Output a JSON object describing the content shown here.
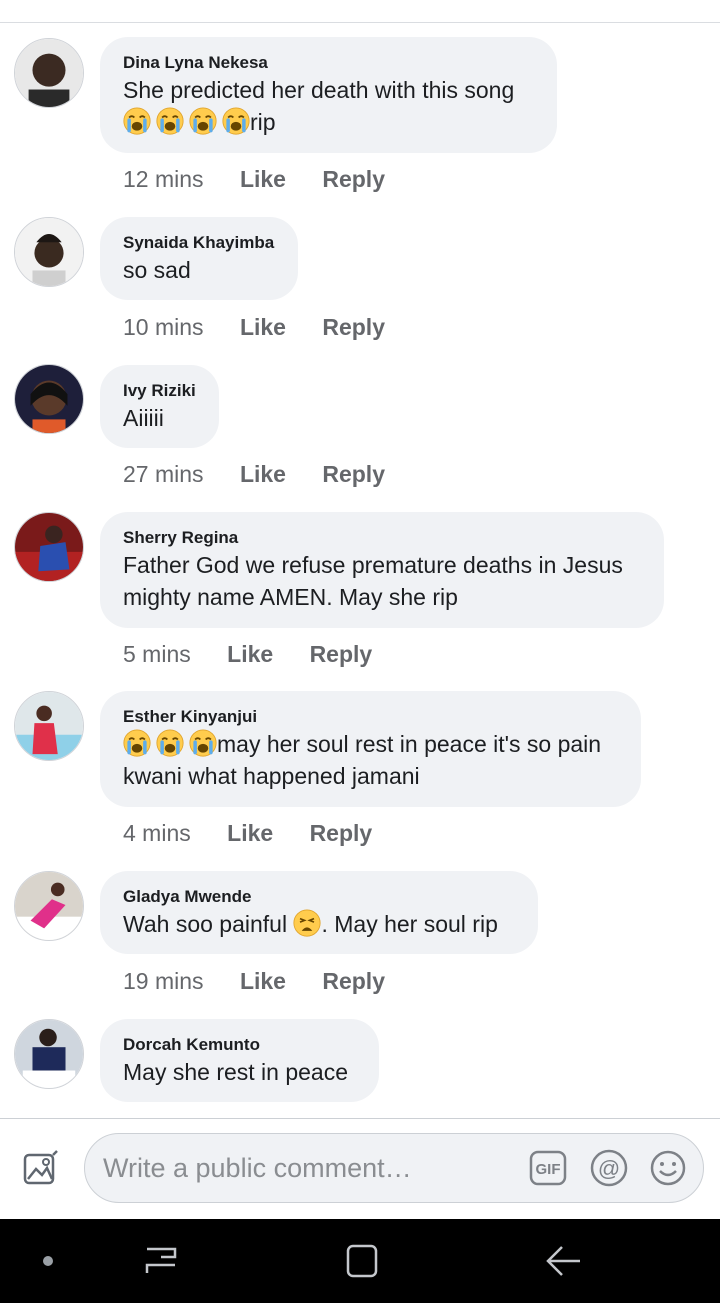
{
  "comments": [
    {
      "author": "Dina Lyna Nekesa",
      "lines": [
        "She predicted her death with this song",
        "rip"
      ],
      "time": "12 mins",
      "like": "Like",
      "reply": "Reply"
    },
    {
      "author": "Synaida Khayimba",
      "lines": [
        "so sad"
      ],
      "time": "10 mins",
      "like": "Like",
      "reply": "Reply"
    },
    {
      "author": "Ivy Riziki",
      "lines": [
        "Aiiiii"
      ],
      "time": "27 mins",
      "like": "Like",
      "reply": "Reply"
    },
    {
      "author": "Sherry Regina",
      "lines": [
        "Father God we refuse premature deaths in Jesus",
        "mighty name AMEN. May she rip"
      ],
      "time": "5 mins",
      "like": "Like",
      "reply": "Reply"
    },
    {
      "author": "Esther Kinyanjui",
      "lines": [
        "may her soul rest in peace it's so pain",
        "kwani what happened jamani"
      ],
      "time": "4 mins",
      "like": "Like",
      "reply": "Reply"
    },
    {
      "author": "Gladya Mwende",
      "lines": [
        "Wah soo painful",
        ". May her soul rip"
      ],
      "time": "19 mins",
      "like": "Like",
      "reply": "Reply"
    },
    {
      "author": "Dorcah Kemunto",
      "lines": [
        "May she rest in peace"
      ]
    }
  ],
  "composer": {
    "placeholder": "Write a public comment…",
    "gif_label": "GIF",
    "mention_label": "@"
  },
  "icons": {
    "photo": "photo-icon",
    "gif": "gif-icon",
    "mention": "at-sign-icon",
    "emoji": "smiley-icon",
    "nav_dot": "dot-icon",
    "nav_recents": "recents-icon",
    "nav_home": "home-icon",
    "nav_back": "back-arrow-icon",
    "crying": "loudly-crying-face-icon",
    "weary": "weary-face-icon"
  },
  "colors": {
    "bubble": "#f0f2f5",
    "meta": "#65676b",
    "text": "#1c1e21",
    "navbar": "#000000"
  }
}
